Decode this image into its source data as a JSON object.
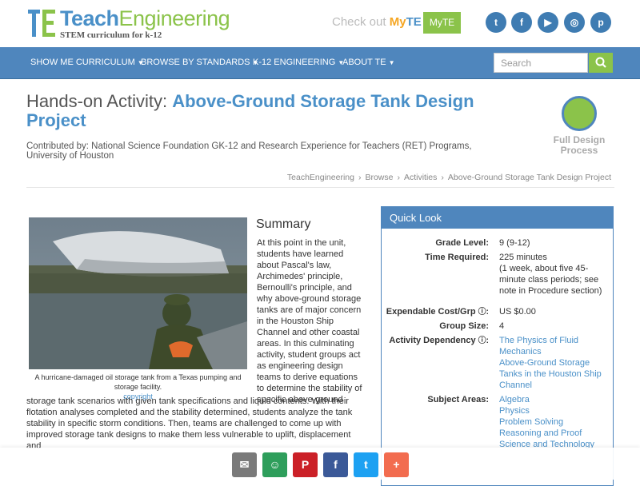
{
  "header": {
    "logo_teach": "Teach",
    "logo_engineering": "Engineering",
    "tagline": "STEM curriculum for k-12",
    "checkout_text": "Check out",
    "myte_word_a": "My",
    "myte_word_b": "TE",
    "myte_button": "MyTE",
    "social_icons": [
      "twitter-icon",
      "facebook-icon",
      "youtube-icon",
      "instagram-icon",
      "pinterest-icon"
    ]
  },
  "nav": {
    "items": [
      "SHOW ME CURRICULUM",
      "BROWSE BY STANDARDS",
      "K-12 ENGINEERING",
      "ABOUT TE"
    ],
    "search_placeholder": "Search"
  },
  "page": {
    "title_prefix": "Hands-on Activity:",
    "title_main": "Above-Ground Storage Tank Design Project",
    "contributed": "Contributed by: National Science Foundation GK-12 and Research Experience for Teachers (RET) Programs, University of Houston",
    "process_label": "Full Design Process",
    "breadcrumb": [
      "TeachEngineering",
      "Browse",
      "Activities",
      "Above-Ground Storage Tank Design Project"
    ]
  },
  "media": {
    "caption": "A hurricane-damaged oil storage tank from a Texas pumping and storage facility.",
    "copyright": "copyright"
  },
  "summary": {
    "heading": "Summary",
    "text_a": "At this point in the unit, students have learned about Pascal's law, Archimedes' principle, Bernoulli's principle, and why above-ground storage tanks are of major concern in the Houston Ship Channel and other coastal areas. In this culminating activity, student groups act as engineering design teams to derive equations to determine the stability of specific above-ground",
    "text_b": "storage tank scenarios with given tank specifications and liquid contents. With their flotation analyses completed and the stability determined, students analyze the tank stability in specific storm conditions. Then, teams are challenged to come up with improved storage tank designs to make them less vulnerable to uplift, displacement and"
  },
  "quicklook": {
    "heading": "Quick Look",
    "grade_label": "Grade Level:",
    "grade_value": "9 (9-12)",
    "time_label": "Time Required:",
    "time_value": "225 minutes",
    "time_note": "(1 week, about five 45-minute class periods; see note in Procedure section)",
    "cost_label": "Expendable Cost/Grp",
    "cost_value": "US $0.00",
    "group_label": "Group Size:",
    "group_value": "4",
    "dependency_label": "Activity Dependency",
    "dependency_links": [
      "The Physics of Fluid Mechanics",
      "Above-Ground Storage Tanks in the Houston Ship Channel"
    ],
    "subject_label": "Subject Areas:",
    "subject_links": [
      "Algebra",
      "Physics",
      "Problem Solving",
      "Reasoning and Proof",
      "Science and Technology"
    ]
  },
  "share": {
    "icons": [
      "email-icon",
      "google-classroom-icon",
      "pinterest-icon",
      "facebook-icon",
      "twitter-icon",
      "more-plus-icon"
    ],
    "colors": [
      "#7a7a7a",
      "#2e9e5b",
      "#cb2027",
      "#3b5998",
      "#1da1f2",
      "#f26c4f"
    ]
  },
  "colors": {
    "brand_blue": "#4f86bd",
    "brand_green": "#8bc34a"
  }
}
